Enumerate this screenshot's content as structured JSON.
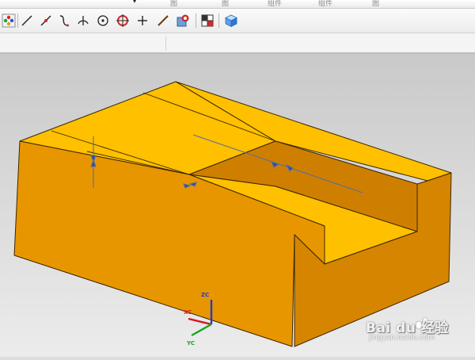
{
  "ribbon": {
    "dropdown_arrow": "▾",
    "labels": [
      "图",
      "组件",
      "组件",
      "图"
    ]
  },
  "toolbar": {
    "icons": [
      "snap-point-icon",
      "line-icon",
      "arc-icon",
      "spline-icon",
      "perpendicular-icon",
      "center-point-icon",
      "quadrant-point-icon",
      "plus-icon",
      "diagonal-line-icon",
      "view-icon",
      "grid-icon",
      "cube-icon"
    ]
  },
  "triad": {
    "x": "XC",
    "y": "YC",
    "z": "ZC"
  },
  "watermark": {
    "text": "Bai du 经验",
    "url": "jingyan.baidu.com"
  },
  "colors": {
    "part_top": "#ffc000",
    "part_front": "#e89600",
    "part_side": "#d58500",
    "edge": "#3b2600",
    "dimension": "#5a6f9a"
  }
}
